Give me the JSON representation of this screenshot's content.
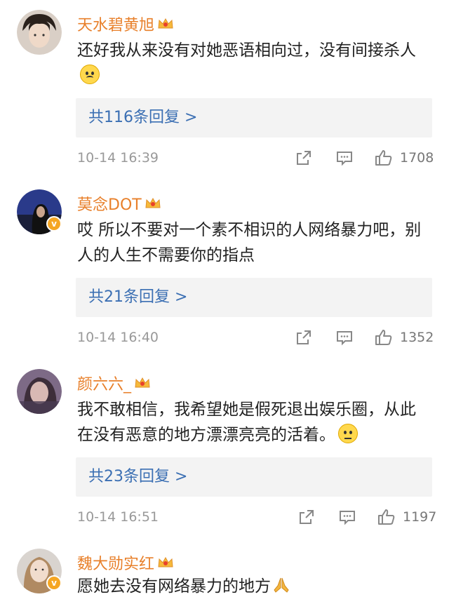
{
  "comments": [
    {
      "username": "天水碧黄旭",
      "text": "还好我从来没有对她恶语相向过，没有间接杀人",
      "emoji": "sad-face-emoji",
      "replies": "共116条回复 >",
      "time": "10-14 16:39",
      "likes": "1708",
      "verified": false
    },
    {
      "username": "莫念DOT",
      "text": "哎  所以不要对一个素不相识的人网络暴力吧，别人的人生不需要你的指点",
      "emoji": "",
      "replies": "共21条回复 >",
      "time": "10-14 16:40",
      "likes": "1352",
      "verified": true
    },
    {
      "username": "颜六六_",
      "text": "我不敢相信，我希望她是假死退出娱乐圈，从此在没有恶意的地方漂漂亮亮的活着。",
      "emoji": "speechless-face-emoji",
      "replies": "共23条回复 >",
      "time": "10-14 16:51",
      "likes": "1197",
      "verified": false
    },
    {
      "username": "魏大勋实红",
      "text": "愿她去没有网络暴力的地方",
      "emoji": "pray-hands-emoji",
      "verified": true
    }
  ],
  "colors": {
    "username": "#e8802b",
    "reply_link": "#3b6fb3",
    "meta": "#999999",
    "reply_bg": "#f3f3f3",
    "badge": "#f5a623"
  }
}
